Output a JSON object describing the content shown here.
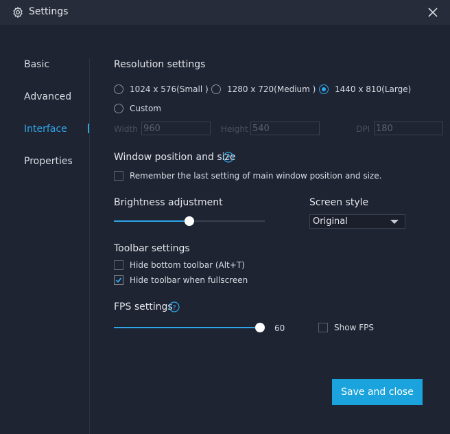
{
  "window": {
    "title": "Settings",
    "title_icon": "gear-icon",
    "close_icon": "close-icon"
  },
  "nav": {
    "items": [
      {
        "label": "Basic",
        "active": false
      },
      {
        "label": "Advanced",
        "active": false
      },
      {
        "label": "Interface",
        "active": true
      },
      {
        "label": "Properties",
        "active": false
      }
    ]
  },
  "resolution": {
    "title": "Resolution settings",
    "options": [
      {
        "label": "1024 x 576(Small )",
        "selected": false
      },
      {
        "label": "1280 x 720(Medium )",
        "selected": false
      },
      {
        "label": "1440 x 810(Large)",
        "selected": true
      },
      {
        "label": "Custom",
        "selected": false
      }
    ],
    "width_label": "Width",
    "width_value": "960",
    "height_label": "Height",
    "height_value": "540",
    "dpi_label": "DPI",
    "dpi_value": "180"
  },
  "window_position": {
    "title": "Window position and size",
    "help_icon": "question-circle-icon",
    "remember_label": "Remember the last setting of main window position and size.",
    "remember_checked": false
  },
  "brightness": {
    "title": "Brightness adjustment",
    "level": 0.5
  },
  "screen_style": {
    "title": "Screen style",
    "value": "Original"
  },
  "toolbar": {
    "title": "Toolbar settings",
    "hide_bottom_label": "Hide bottom toolbar (Alt+T)",
    "hide_bottom_checked": false,
    "hide_fullscreen_label": "Hide toolbar when fullscreen",
    "hide_fullscreen_checked": true
  },
  "fps": {
    "title": "FPS settings",
    "help_icon": "question-circle-icon",
    "value": "60",
    "level": 1.0,
    "show_fps_label": "Show FPS",
    "show_fps_checked": false
  },
  "actions": {
    "save_label": "Save and close"
  },
  "colors": {
    "background": "#1f2433",
    "titlebar": "#272c3a",
    "accent": "#2fa6e8",
    "button": "#1aa3dc"
  }
}
